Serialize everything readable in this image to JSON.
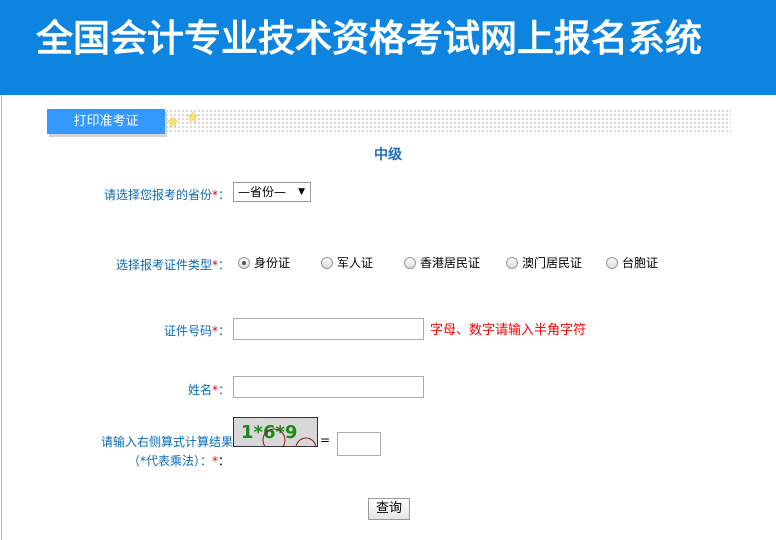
{
  "header": {
    "title": "全国会计专业技术资格考试网上报名系统"
  },
  "tab": {
    "label": "打印准考证"
  },
  "level": "中级",
  "form": {
    "province_label": "请选择您报考的省份",
    "province_value": "—省份—",
    "required": "*",
    "colon": "：",
    "idtype_label": "选择报考证件类型",
    "idtypes": [
      "身份证",
      "军人证",
      "香港居民证",
      "澳门居民证",
      "台胞证"
    ],
    "idno_label": "证件号码",
    "idno_hint": "字母、数字请输入半角字符",
    "name_label": "姓名",
    "captcha_label1": "请输入右侧算式计算结果",
    "captcha_label2": "（*代表乘法）：",
    "captcha_text": "1*6*9",
    "equals": "=",
    "submit": "查询"
  }
}
